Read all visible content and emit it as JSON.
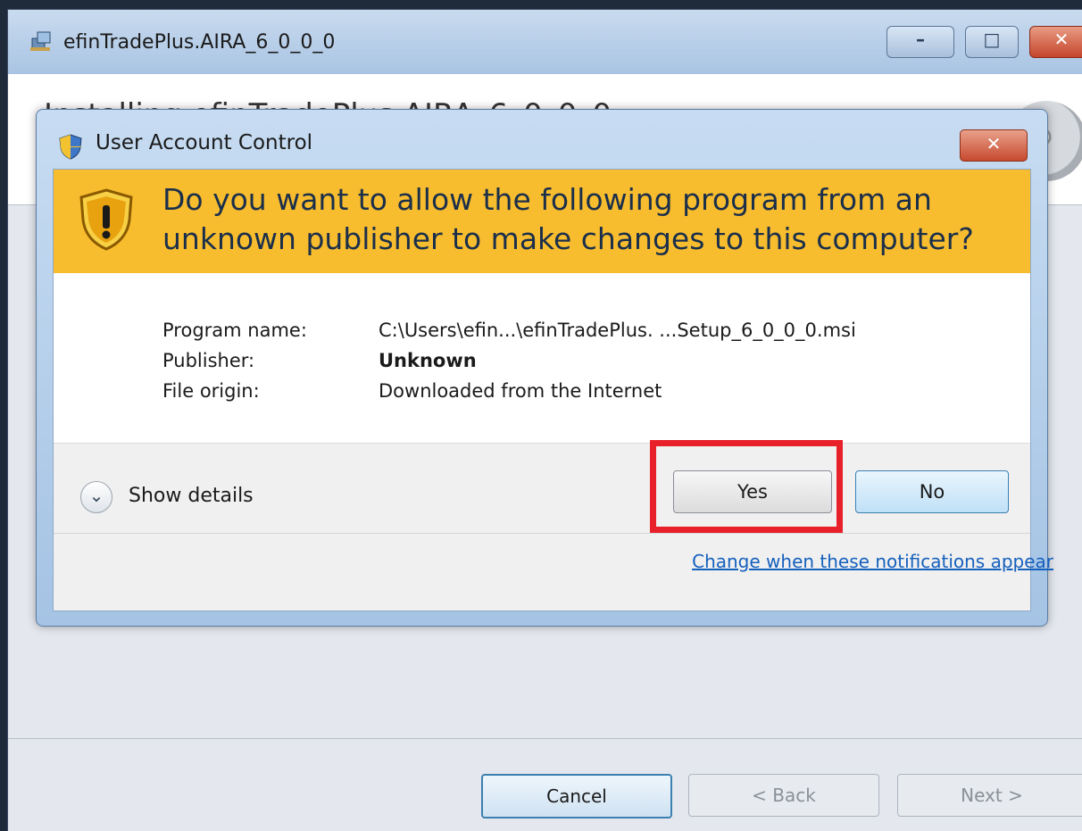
{
  "installer": {
    "title": "efinTradePlus.AIRA_6_0_0_0",
    "heading": "Installing efinTradePlus.AIRA_6_0_0_0",
    "buttons": {
      "cancel": "Cancel",
      "back": "< Back",
      "next": "Next >"
    }
  },
  "uac": {
    "title": "User Account Control",
    "question": "Do you want to allow the following program from an unknown publisher to make changes to this computer?",
    "fields": [
      {
        "label": "Program name:",
        "value": "C:\\Users\\efin...\\efinTradePlus.      ...Setup_6_0_0_0.msi"
      },
      {
        "label": "Publisher:",
        "value": "Unknown"
      },
      {
        "label": "File origin:",
        "value": "Downloaded from the Internet"
      }
    ],
    "show_details": "Show details",
    "yes_label": "Yes",
    "no_label": "No",
    "change_link": "Change when these notifications appear"
  },
  "colors": {
    "banner": "#f8bd2e",
    "highlight": "#e8202a",
    "link": "#1560bd"
  }
}
